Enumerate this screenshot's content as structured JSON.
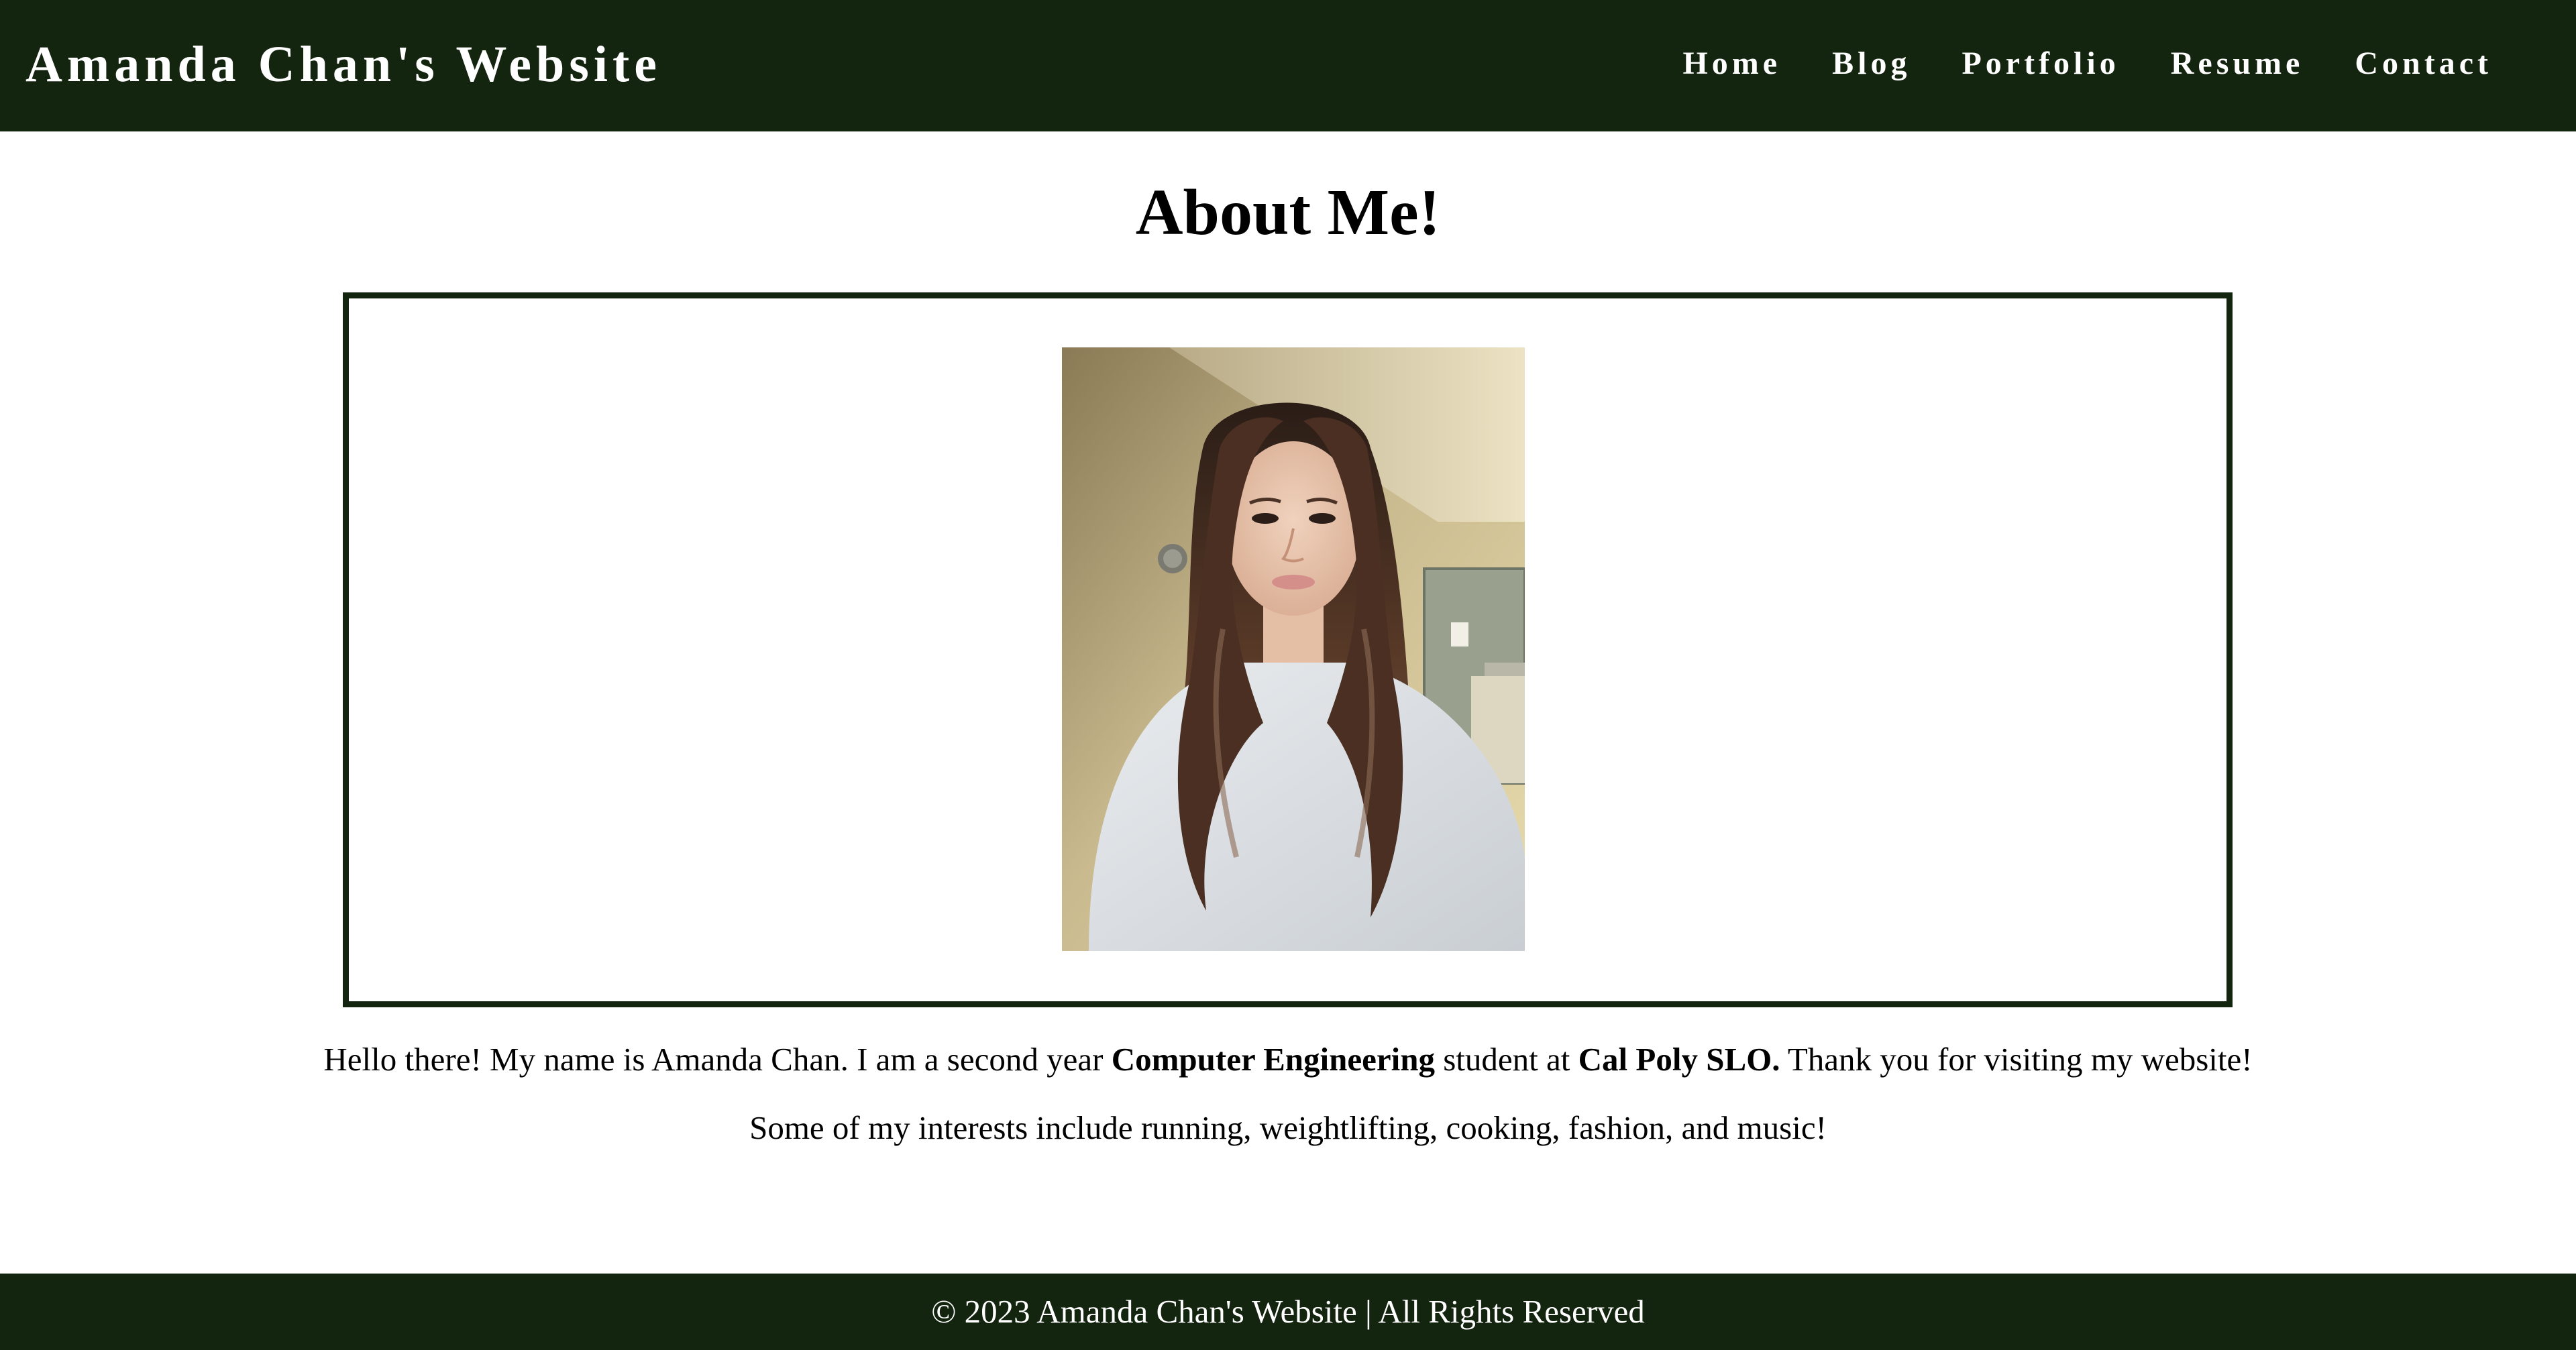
{
  "header": {
    "site_title": "Amanda Chan's Website",
    "nav": [
      {
        "label": "Home"
      },
      {
        "label": "Blog"
      },
      {
        "label": "Portfolio"
      },
      {
        "label": "Resume"
      },
      {
        "label": "Contact"
      }
    ]
  },
  "main": {
    "page_title": "About Me!",
    "bio": {
      "line1_part1": "Hello there! My name is Amanda Chan. I am a second year ",
      "line1_bold1": "Computer Engineering",
      "line1_part2": " student at ",
      "line1_bold2": "Cal Poly SLO.",
      "line1_part3": " Thank you for visiting my website!",
      "line2": "Some of my interests include running, weightlifting, cooking, fashion, and music!"
    }
  },
  "footer": {
    "copyright": "© 2023 Amanda Chan's Website | All Rights Reserved"
  },
  "colors": {
    "header_bg": "#13240f",
    "footer_bg": "#13240f",
    "frame_border": "#13240f",
    "header_text": "#ffffff",
    "body_text": "#000000"
  }
}
